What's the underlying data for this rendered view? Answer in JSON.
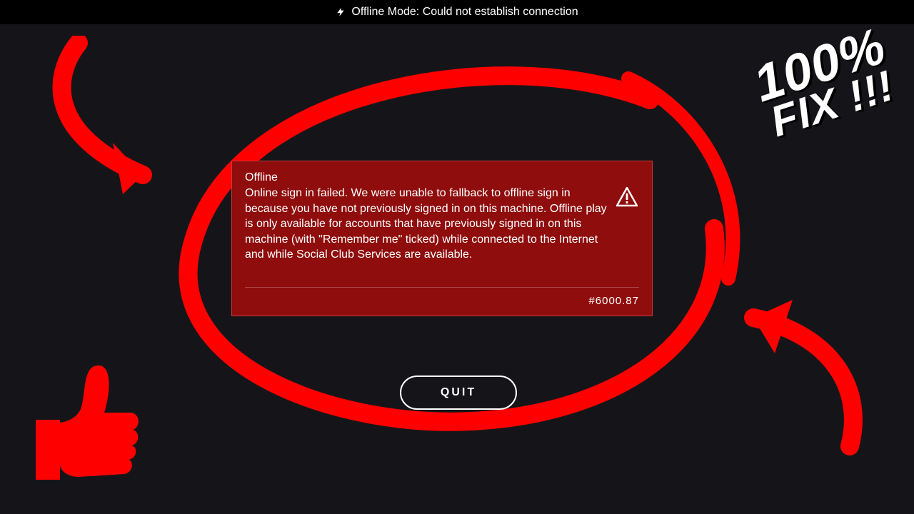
{
  "topbar": {
    "status_text": "Offline Mode: Could not establish connection"
  },
  "error": {
    "title": "Offline",
    "message": "Online sign in failed. We were unable to fallback to offline sign in because you have not previously signed in on this machine. Offline play is only available for accounts that have previously signed in on this machine (with \"Remember me\" ticked) while connected to the Internet and while Social Club Services are available.",
    "code": "#6000.87"
  },
  "actions": {
    "quit_label": "QUIT"
  },
  "annotations": {
    "fix_line1": "100%",
    "fix_line2": "FIX !!!"
  },
  "colors": {
    "accent_red": "#ff0000",
    "error_bg": "#8f0d0d"
  }
}
